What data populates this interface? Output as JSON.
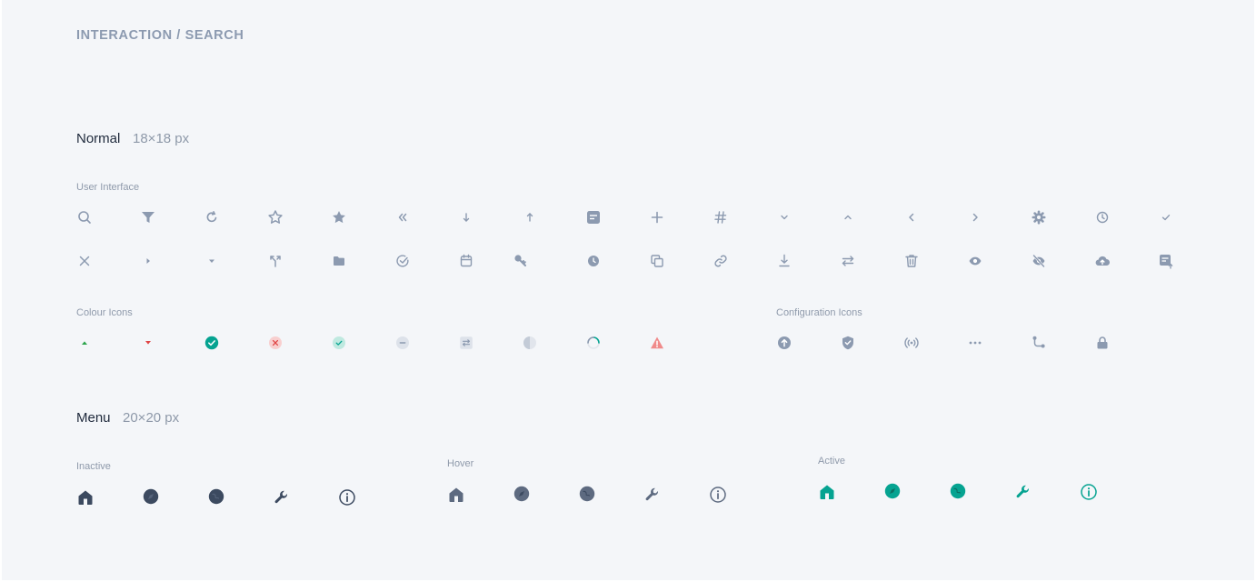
{
  "page": {
    "title": "INTERACTION / SEARCH"
  },
  "normal": {
    "title": "Normal",
    "size": "18×18 px",
    "user_interface": {
      "label": "User Interface",
      "row1": [
        "search",
        "filter",
        "refresh",
        "star-outline",
        "star-filled",
        "chevrons-left",
        "arrow-down",
        "arrow-up",
        "note",
        "plus",
        "hash",
        "chevron-down",
        "chevron-up",
        "chevron-left",
        "chevron-right",
        "gear",
        "clock",
        "check"
      ],
      "row2": [
        "close",
        "caret-right",
        "caret-down",
        "merge",
        "folder",
        "check-circle",
        "calendar",
        "key",
        "clock-filled",
        "copy",
        "link",
        "download",
        "swap",
        "trash",
        "eye",
        "eye-off",
        "cloud-upload",
        "note-upload"
      ]
    },
    "colour_icons": {
      "label": "Colour Icons",
      "icons": [
        "triangle-up",
        "triangle-down",
        "status-success",
        "status-error",
        "status-success-light",
        "status-neutral",
        "status-transfer",
        "pie-progress",
        "spinner",
        "warning"
      ]
    },
    "configuration_icons": {
      "label": "Configuration Icons",
      "icons": [
        "arrow-up-circle",
        "shield-check",
        "broadcast",
        "more-dots",
        "route",
        "lock"
      ]
    }
  },
  "menu": {
    "title": "Menu",
    "size": "20×20 px",
    "inactive": {
      "label": "Inactive",
      "color": "#3c4a60",
      "icons": [
        "home",
        "compass",
        "globe",
        "wrench",
        "info"
      ]
    },
    "hover": {
      "label": "Hover",
      "color": "#5d6a80",
      "icons": [
        "home",
        "compass",
        "globe",
        "wrench",
        "info"
      ]
    },
    "active": {
      "label": "Active",
      "color": "#05a391",
      "icons": [
        "home",
        "compass",
        "globe",
        "wrench",
        "info"
      ]
    }
  },
  "colors": {
    "icon_default": "#8c9ab0",
    "accent_teal": "#05a391",
    "success_green": "#2aa34a",
    "error_red": "#e04545",
    "warning_red": "#f08a8a"
  }
}
